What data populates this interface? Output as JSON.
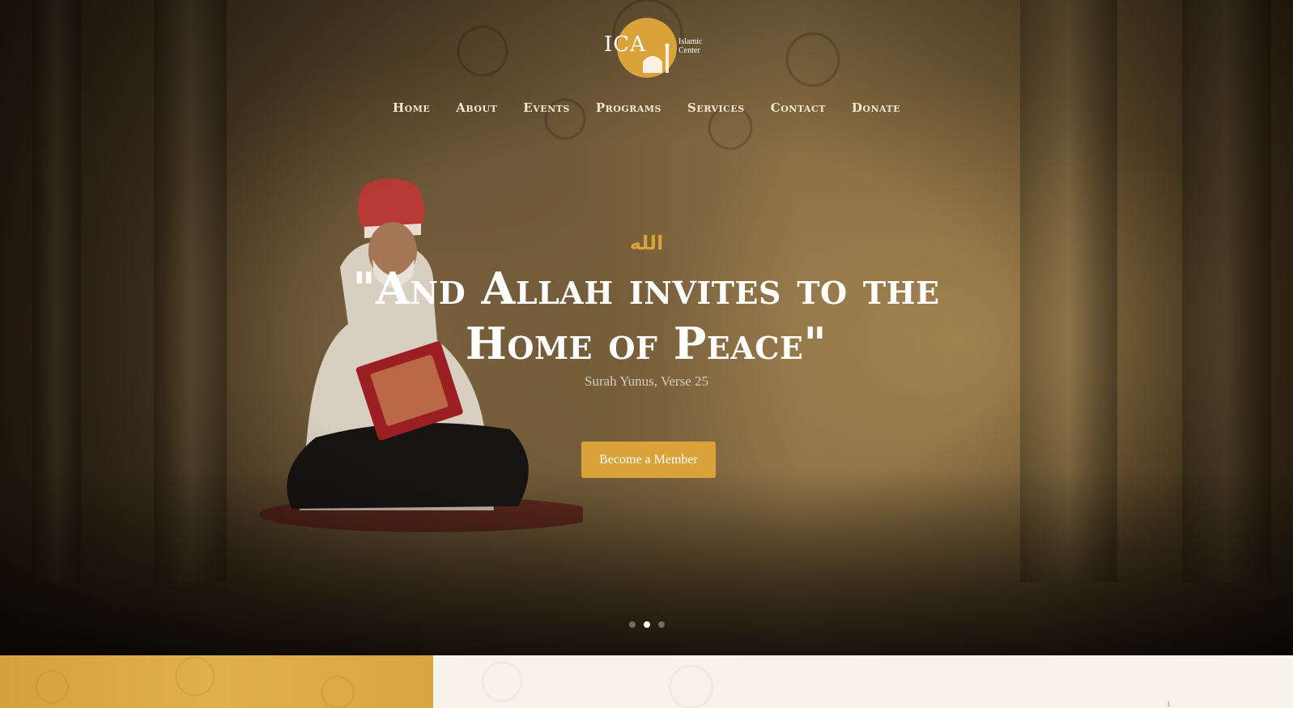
{
  "logo": {
    "mark_text": "ICA",
    "subtitle_line1": "Islamic",
    "subtitle_line2": "Center",
    "accent": "#d9a33a"
  },
  "nav": {
    "items": [
      "Home",
      "About",
      "Events",
      "Programs",
      "Services",
      "Contact",
      "Donate"
    ]
  },
  "hero": {
    "arabic_text": "الله",
    "headline_line1": "\"And Allah invites to the",
    "headline_line2": "Home of Peace\"",
    "subline": "Surah Yunus, Verse 25",
    "cta_label": "Become a Member",
    "slides_total": 3,
    "active_slide": 2
  },
  "strip": {
    "number": "1"
  },
  "colors": {
    "accent": "#d9a33a",
    "headline": "#ffffff",
    "light_panel": "#f7f2ea"
  }
}
